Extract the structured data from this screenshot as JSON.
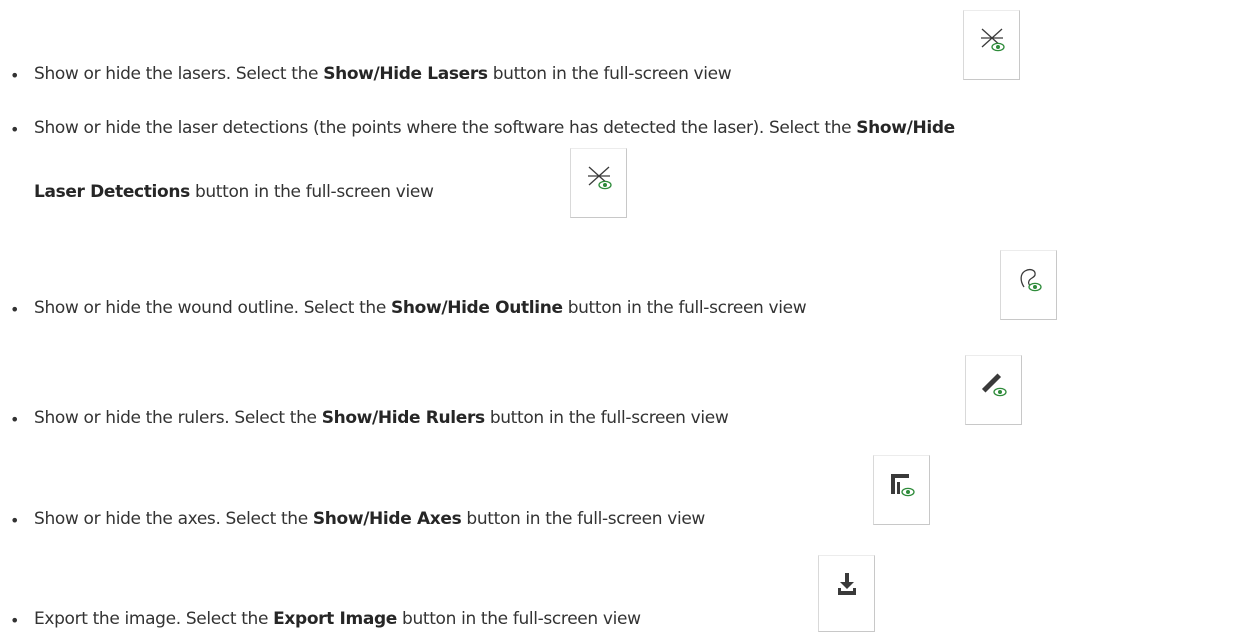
{
  "items": [
    {
      "intro": "Show or hide the lasers. Select the ",
      "bold": "Show/Hide Lasers",
      "outro": " button in the full-screen view",
      "icon": "laser-eye-icon"
    },
    {
      "intro": "Show or hide the laser detections (the points where the software has detected the laser). Select the ",
      "bold": "Show/Hide",
      "bold2": "Laser Detections",
      "outro": " button in the full-screen view",
      "icon": "laser-detections-eye-icon"
    },
    {
      "intro": "Show or hide the wound outline. Select the ",
      "bold": "Show/Hide Outline",
      "outro": " button in the full-screen view",
      "icon": "outline-eye-icon"
    },
    {
      "intro": "Show or hide the rulers. Select the ",
      "bold": "Show/Hide Rulers",
      "outro": " button in the full-screen view",
      "icon": "ruler-eye-icon"
    },
    {
      "intro": "Show or hide the axes. Select the ",
      "bold": "Show/Hide Axes",
      "outro": " button in the full-screen view",
      "icon": "axes-eye-icon"
    },
    {
      "intro": "Export the image. Select the ",
      "bold": "Export Image",
      "outro": " button in the full-screen view",
      "icon": "download-icon"
    }
  ],
  "bullet_glyph": "•",
  "colors": {
    "text": "#333333",
    "eye_green": "#2e8b3a",
    "icon_dark": "#3a3a3a"
  }
}
